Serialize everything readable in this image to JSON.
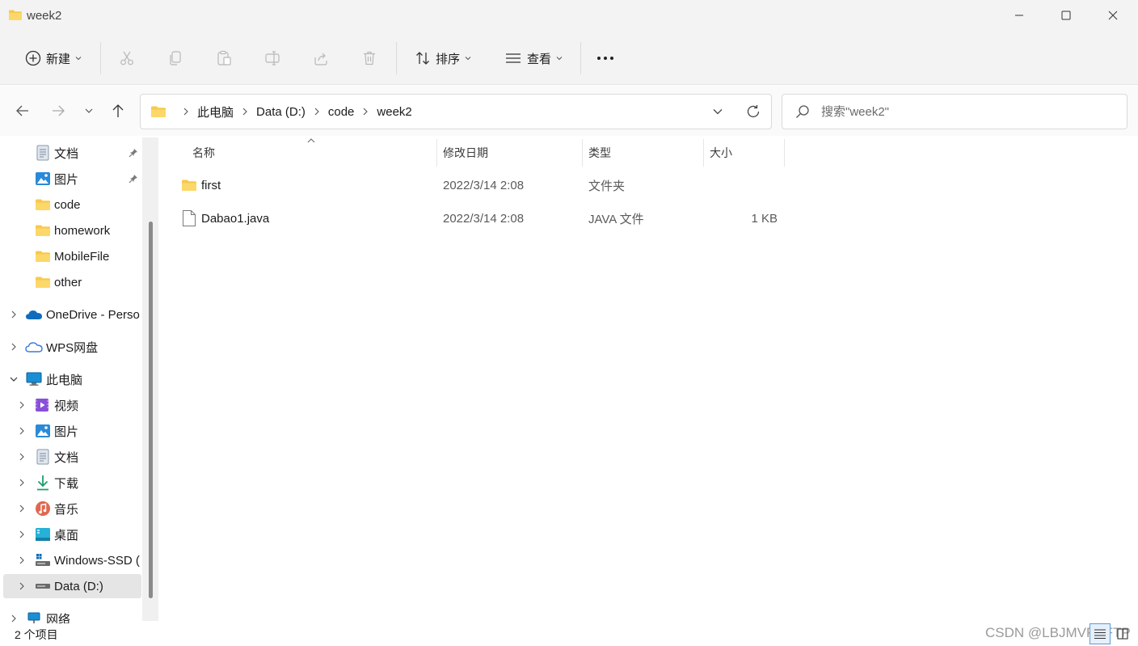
{
  "window": {
    "title": "week2",
    "controls": {
      "minimize": "minimize",
      "maximize": "maximize",
      "close": "close"
    }
  },
  "toolbar": {
    "new_label": "新建",
    "sort_label": "排序",
    "view_label": "查看",
    "icons": [
      "plus-circle-icon",
      "cut-icon",
      "copy-icon",
      "paste-icon",
      "rename-icon",
      "share-icon",
      "delete-icon",
      "sort-icon",
      "view-icon",
      "more-icon"
    ]
  },
  "breadcrumb": [
    "此电脑",
    "Data (D:)",
    "code",
    "week2"
  ],
  "search": {
    "placeholder": "搜索\"week2\""
  },
  "nav": {
    "quick_access": [
      {
        "label": "文档",
        "icon": "documents-icon",
        "pinned": true
      },
      {
        "label": "图片",
        "icon": "pictures-icon",
        "pinned": true
      },
      {
        "label": "code",
        "icon": "folder-icon",
        "pinned": false
      },
      {
        "label": "homework",
        "icon": "folder-icon",
        "pinned": false
      },
      {
        "label": "MobileFile",
        "icon": "folder-icon",
        "pinned": false
      },
      {
        "label": "other",
        "icon": "folder-icon",
        "pinned": false
      }
    ],
    "onedrive": "OneDrive - Perso",
    "wps": "WPS网盘",
    "thispc": "此电脑",
    "thispc_children": [
      {
        "label": "视频",
        "icon": "videos-icon"
      },
      {
        "label": "图片",
        "icon": "pictures-icon"
      },
      {
        "label": "文档",
        "icon": "documents-icon"
      },
      {
        "label": "下载",
        "icon": "downloads-icon"
      },
      {
        "label": "音乐",
        "icon": "music-icon"
      },
      {
        "label": "桌面",
        "icon": "desktop-icon"
      },
      {
        "label": "Windows-SSD (",
        "icon": "drive-c-icon"
      },
      {
        "label": "Data (D:)",
        "icon": "drive-icon"
      }
    ],
    "network": "网络"
  },
  "columns": {
    "name": "名称",
    "date": "修改日期",
    "type": "类型",
    "size": "大小"
  },
  "files": [
    {
      "name": "first",
      "date": "2022/3/14 2:08",
      "type": "文件夹",
      "size": "",
      "icon": "folder-icon"
    },
    {
      "name": "Dabao1.java",
      "date": "2022/3/14 2:08",
      "type": "JAVA 文件",
      "size": "1 KB",
      "icon": "file-icon"
    }
  ],
  "status": {
    "item_count": "2 个项目"
  },
  "watermark": "CSDN @LBJMVPEFTP",
  "colors": {
    "folder": "#f8c94a",
    "accent": "#0067c0",
    "selection": "#e5e5e5"
  }
}
